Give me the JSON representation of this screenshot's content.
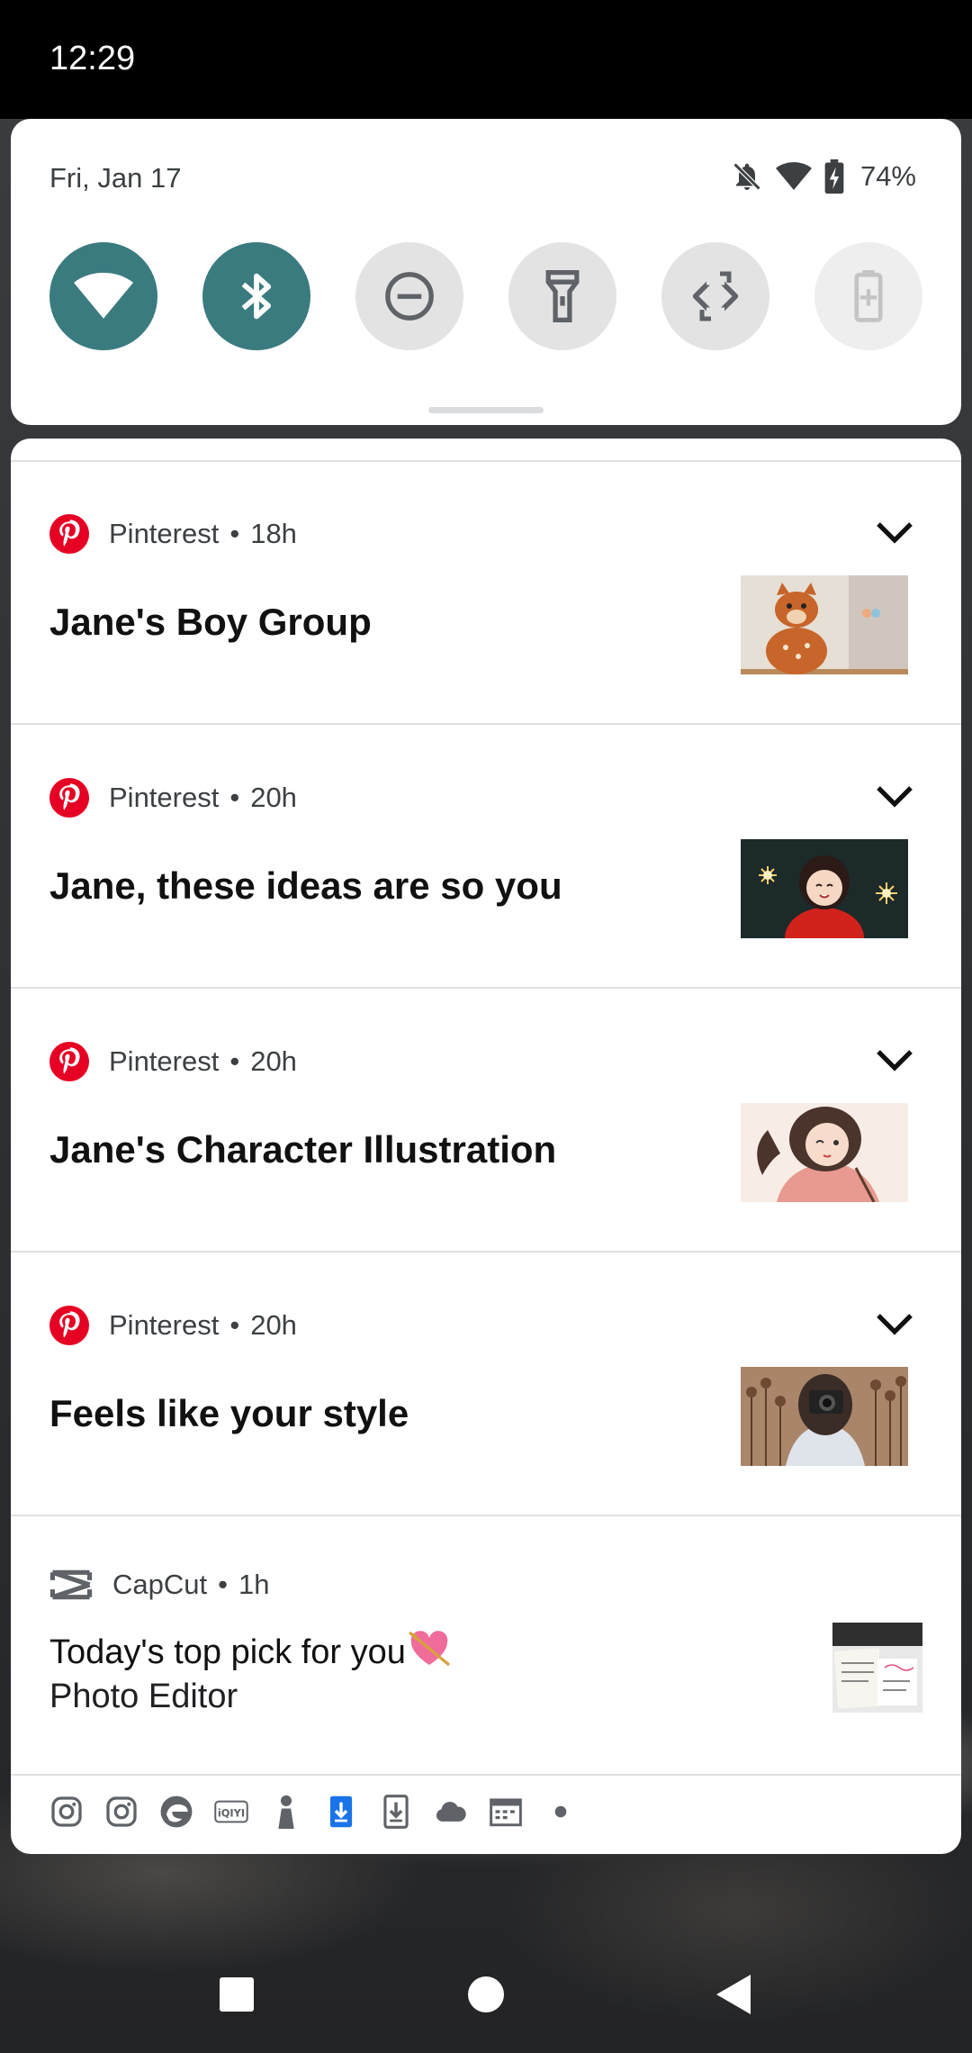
{
  "status_bar": {
    "time": "12:29"
  },
  "quick_settings": {
    "date": "Fri, Jan 17",
    "battery_percent": "74%",
    "tiles": [
      {
        "name": "wifi",
        "state": "on"
      },
      {
        "name": "bluetooth",
        "state": "on"
      },
      {
        "name": "do-not-disturb",
        "state": "off"
      },
      {
        "name": "flashlight",
        "state": "off"
      },
      {
        "name": "auto-rotate",
        "state": "off"
      },
      {
        "name": "battery-saver",
        "state": "disabled"
      }
    ],
    "accent_color": "#3a7b80"
  },
  "notifications": [
    {
      "app": "Pinterest",
      "age": "18h",
      "title": "Jane's Boy Group"
    },
    {
      "app": "Pinterest",
      "age": "20h",
      "title": "Jane, these ideas are so you"
    },
    {
      "app": "Pinterest",
      "age": "20h",
      "title": "Jane's Character Illustration"
    },
    {
      "app": "Pinterest",
      "age": "20h",
      "title": "Feels like your style"
    }
  ],
  "capcut": {
    "app": "CapCut",
    "age": "1h",
    "line1": "Today's top pick for you",
    "line2": "Photo Editor"
  },
  "separator": "•",
  "notification_icons": [
    "instagram-icon",
    "instagram-icon",
    "edge-icon",
    "iqiyi-icon",
    "person-icon",
    "download-icon",
    "download-icon",
    "cloud-icon",
    "calendar-icon",
    "more-dot-icon"
  ],
  "colors": {
    "pinterest": "#e60023",
    "download_blue": "#1a73e8"
  }
}
